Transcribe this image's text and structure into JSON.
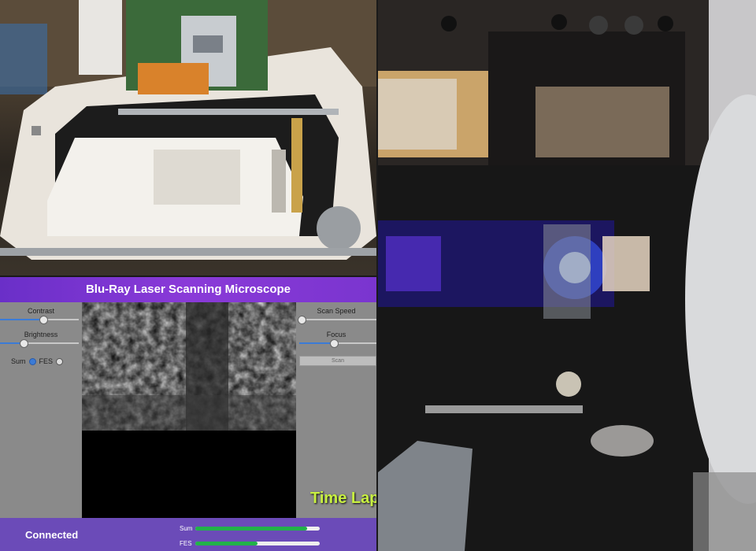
{
  "app": {
    "title": "Blu-Ray Laser Scanning Microscope",
    "overlay_caption": "Time Lap",
    "status": "Connected",
    "left_controls": {
      "contrast_label": "Contrast",
      "contrast_value": 0.55,
      "brightness_label": "Brightness",
      "brightness_value": 0.3,
      "mode_sum_label": "Sum",
      "mode_fes_label": "FES",
      "selected_mode": "Sum"
    },
    "right_controls": {
      "scan_speed_label": "Scan Speed",
      "scan_speed_value": 0.03,
      "focus_label": "Focus",
      "focus_value": 0.45,
      "action_button_label": "Scan"
    },
    "meters": [
      {
        "label": "Sum",
        "value": 0.9
      },
      {
        "label": "FES",
        "value": 0.5
      }
    ]
  },
  "colors": {
    "header_purple": "#7a35cf",
    "status_purple": "#6b4bb8",
    "slider_blue": "#3b7bd6",
    "meter_green": "#22b24a",
    "caption_lime": "#c8f040"
  }
}
